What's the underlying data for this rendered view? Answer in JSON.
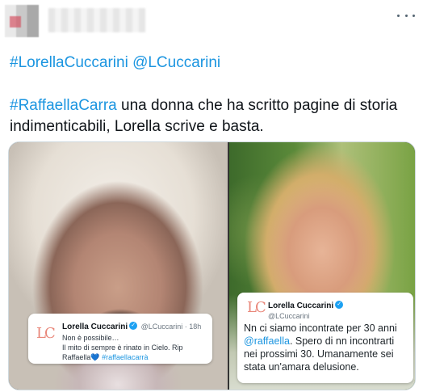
{
  "header": {
    "more_icon": "more-horizontal-icon"
  },
  "tweet": {
    "line1_tag1": "#LorellaCuccarini",
    "line1_tag2": "@LCuccarini",
    "body_tag": "#RaffaellaCarra",
    "body_text": " una donna che ha scritto pagine di storia indimenticabili, Lorella scrive e basta."
  },
  "card_left": {
    "logo": "LC",
    "name": "Lorella Cuccarini",
    "handle": "@LCuccarini · 18h",
    "line1": "Non è possibile…",
    "line2": "Il mito di sempre è rinato in Cielo. Rip",
    "line3_text": "Raffaella",
    "heart": "💙",
    "line3_tag": " #raffaellacarrà"
  },
  "card_right": {
    "logo": "LC",
    "name": "Lorella Cuccarini",
    "handle": "@LCuccarini",
    "text_pre": "Nn ci siamo incontrate per 30 anni ",
    "mention": "@raffaella",
    "text_post": ". Spero di nn incontrarti nei prossimi 30. Umanamente sei stata un'amara delusione."
  },
  "colors": {
    "link": "#1b95e0",
    "logo": "#e9877a",
    "verified": "#1da1f2"
  }
}
